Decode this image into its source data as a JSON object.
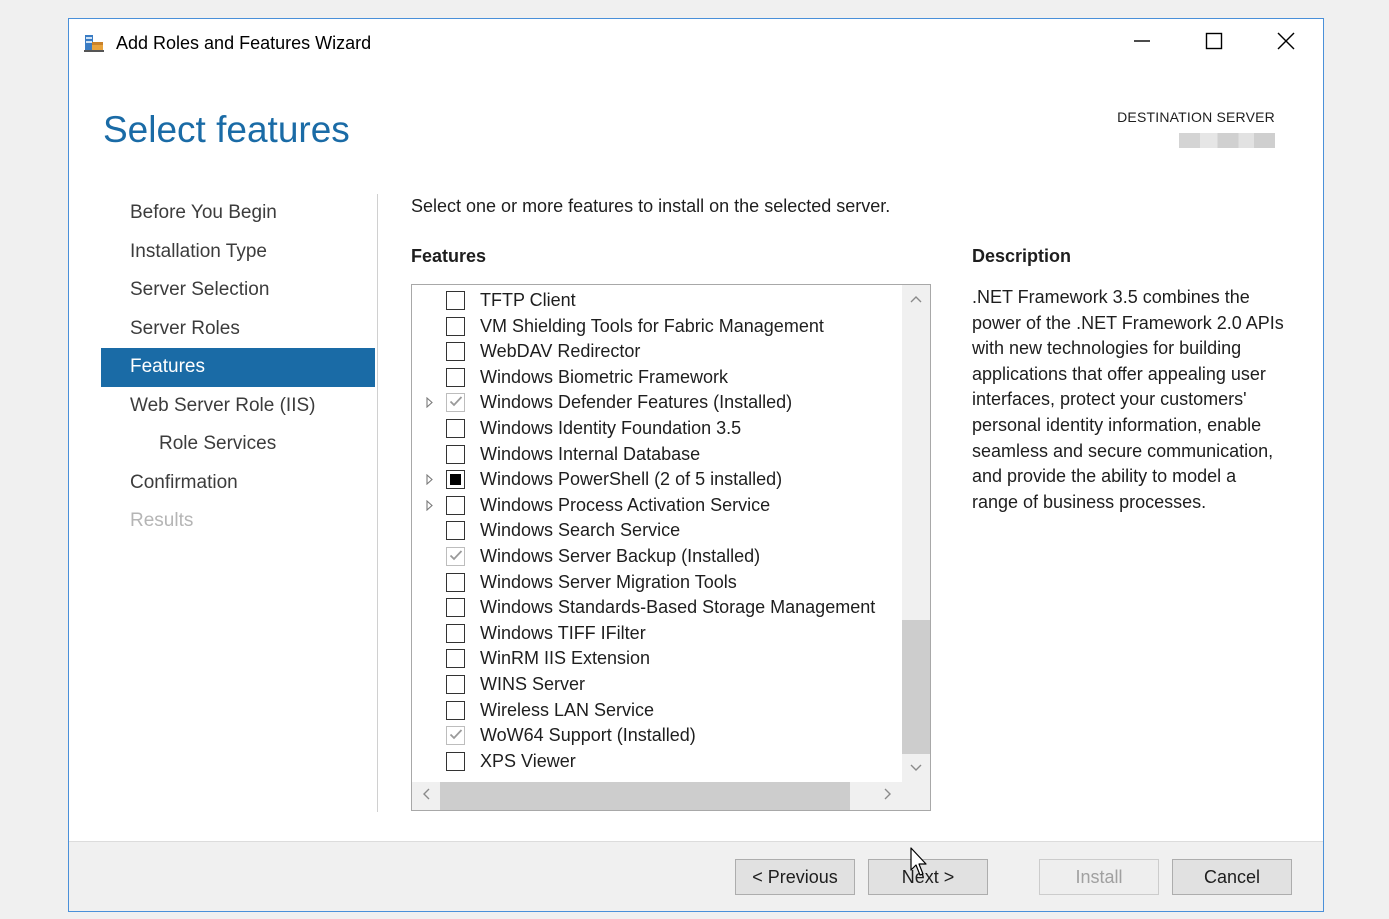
{
  "window": {
    "title": "Add Roles and Features Wizard",
    "accent_color": "#1a6ba6",
    "controls": {
      "minimize_icon": "minimize-icon",
      "maximize_icon": "maximize-icon",
      "close_icon": "close-icon"
    }
  },
  "header": {
    "page_title": "Select features",
    "destination_label": "DESTINATION SERVER"
  },
  "nav": {
    "items": [
      {
        "label": "Before You Begin",
        "state": "normal"
      },
      {
        "label": "Installation Type",
        "state": "normal"
      },
      {
        "label": "Server Selection",
        "state": "normal"
      },
      {
        "label": "Server Roles",
        "state": "normal"
      },
      {
        "label": "Features",
        "state": "active"
      },
      {
        "label": "Web Server Role (IIS)",
        "state": "normal"
      },
      {
        "label": "Role Services",
        "state": "sub"
      },
      {
        "label": "Confirmation",
        "state": "normal"
      },
      {
        "label": "Results",
        "state": "disabled"
      }
    ]
  },
  "main": {
    "instructions": "Select one or more features to install on the selected server.",
    "features_label": "Features",
    "description_label": "Description",
    "description_text": ".NET Framework 3.5 combines the power of the .NET Framework 2.0 APIs with new technologies for building applications that offer appealing user interfaces, protect your customers' personal identity information, enable seamless and secure communication, and provide the ability to model a range of business processes.",
    "features": [
      {
        "label": "TFTP Client",
        "state": "unchecked",
        "expandable": false
      },
      {
        "label": "VM Shielding Tools for Fabric Management",
        "state": "unchecked",
        "expandable": false
      },
      {
        "label": "WebDAV Redirector",
        "state": "unchecked",
        "expandable": false
      },
      {
        "label": "Windows Biometric Framework",
        "state": "unchecked",
        "expandable": false
      },
      {
        "label": "Windows Defender Features (Installed)",
        "state": "installed",
        "expandable": true
      },
      {
        "label": "Windows Identity Foundation 3.5",
        "state": "unchecked",
        "expandable": false
      },
      {
        "label": "Windows Internal Database",
        "state": "unchecked",
        "expandable": false
      },
      {
        "label": "Windows PowerShell (2 of 5 installed)",
        "state": "partial",
        "expandable": true
      },
      {
        "label": "Windows Process Activation Service",
        "state": "unchecked",
        "expandable": true
      },
      {
        "label": "Windows Search Service",
        "state": "unchecked",
        "expandable": false
      },
      {
        "label": "Windows Server Backup (Installed)",
        "state": "installed",
        "expandable": false
      },
      {
        "label": "Windows Server Migration Tools",
        "state": "unchecked",
        "expandable": false
      },
      {
        "label": "Windows Standards-Based Storage Management",
        "state": "unchecked",
        "expandable": false
      },
      {
        "label": "Windows TIFF IFilter",
        "state": "unchecked",
        "expandable": false
      },
      {
        "label": "WinRM IIS Extension",
        "state": "unchecked",
        "expandable": false
      },
      {
        "label": "WINS Server",
        "state": "unchecked",
        "expandable": false
      },
      {
        "label": "Wireless LAN Service",
        "state": "unchecked",
        "expandable": false
      },
      {
        "label": "WoW64 Support (Installed)",
        "state": "installed",
        "expandable": false
      },
      {
        "label": "XPS Viewer",
        "state": "unchecked",
        "expandable": false
      }
    ]
  },
  "footer": {
    "previous_label": "< Previous",
    "next_label": "Next >",
    "install_label": "Install",
    "cancel_label": "Cancel"
  }
}
